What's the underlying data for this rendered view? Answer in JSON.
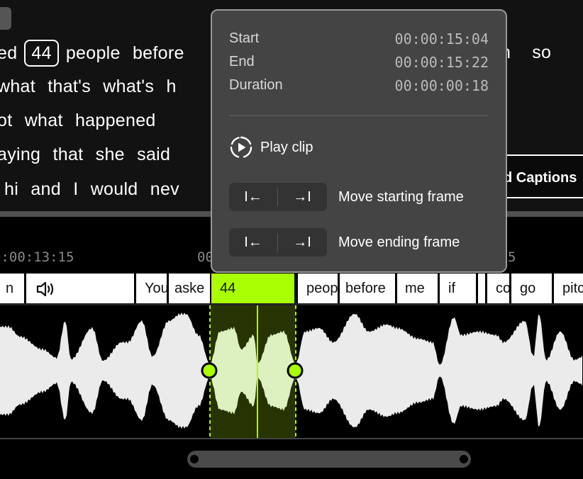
{
  "transcript": {
    "lines": [
      [
        "ed",
        "44",
        "people",
        "before"
      ],
      [
        "what",
        "that's",
        "what's",
        "h"
      ],
      [
        "ot",
        "what",
        "happened"
      ],
      [
        "aying",
        "that",
        "she",
        "said"
      ],
      [
        "hi",
        "and",
        "I",
        "would",
        "nev"
      ]
    ],
    "highlighted_word": "44",
    "right_fragment_line1": [
      "n",
      "so"
    ],
    "captions_button": "d Captions"
  },
  "popup": {
    "start_label": "Start",
    "start_value": "00:00:15:04",
    "end_label": "End",
    "end_value": "00:00:15:22",
    "duration_label": "Duration",
    "duration_value": "00:00:00:18",
    "play_clip": "Play clip",
    "move_start_label": "Move starting frame",
    "move_end_label": "Move ending frame",
    "step_back_glyph": "I←",
    "step_forward_glyph": "→I"
  },
  "timeline": {
    "timecodes": [
      "0:00:13:15",
      "00",
      "5"
    ],
    "words": [
      {
        "text": "n"
      },
      {
        "text": "",
        "icon": "speaker-icon"
      },
      {
        "text": "You"
      },
      {
        "text": "aske"
      },
      {
        "text": "44",
        "selected": true
      },
      {
        "text": "peop"
      },
      {
        "text": "before"
      },
      {
        "text": "me"
      },
      {
        "text": "if"
      },
      {
        "text": ""
      },
      {
        "text": "co"
      },
      {
        "text": "go"
      },
      {
        "text": "pitc"
      }
    ],
    "selection_color": "#aaff00"
  }
}
